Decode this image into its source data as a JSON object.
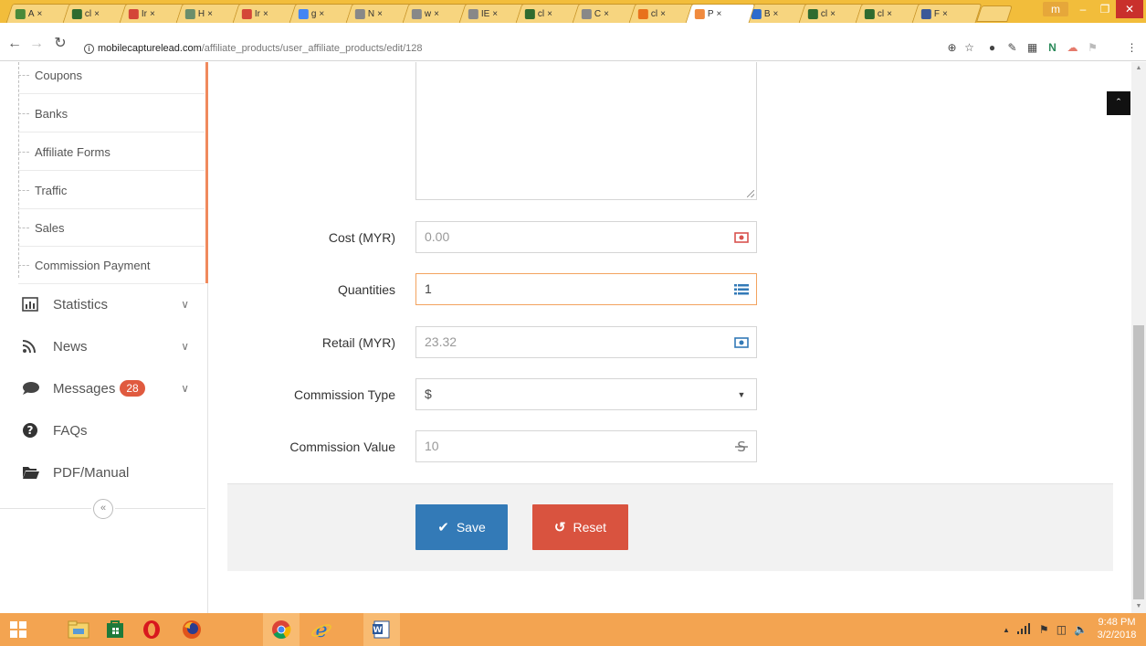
{
  "browser": {
    "tabs": [
      {
        "label": "A",
        "icon": "sheets-icon",
        "color": "#4a8a3a"
      },
      {
        "label": "cl",
        "icon": "circle-icon",
        "color": "#2f6b2f"
      },
      {
        "label": "Ir",
        "icon": "gmail-icon",
        "color": "#d44638"
      },
      {
        "label": "H",
        "icon": "page-icon",
        "color": "#6b8e6b"
      },
      {
        "label": "Ir",
        "icon": "gmail-icon",
        "color": "#d44638"
      },
      {
        "label": "g",
        "icon": "google-icon",
        "color": "#4285f4"
      },
      {
        "label": "N",
        "icon": "doc-icon",
        "color": "#888888"
      },
      {
        "label": "w",
        "icon": "doc-icon",
        "color": "#888888"
      },
      {
        "label": "IE",
        "icon": "doc-icon",
        "color": "#888888"
      },
      {
        "label": "cl",
        "icon": "circle-icon",
        "color": "#2f6b2f"
      },
      {
        "label": "C",
        "icon": "doc-icon",
        "color": "#888888"
      },
      {
        "label": "cl",
        "icon": "link-icon",
        "color": "#e8711c"
      },
      {
        "label": "P",
        "icon": "app-icon",
        "color": "#f08a3e"
      },
      {
        "label": "B",
        "icon": "b-icon",
        "color": "#2d6bcc"
      },
      {
        "label": "cl",
        "icon": "circle-icon",
        "color": "#2f6b2f"
      },
      {
        "label": "cl",
        "icon": "circle-icon",
        "color": "#2f6b2f"
      },
      {
        "label": "F",
        "icon": "facebook-icon",
        "color": "#3b5998"
      }
    ],
    "active_tab_index": 12,
    "profile_label": "m",
    "url_host": "mobilecapturelead.com",
    "url_path": "/affiliate_products/user_affiliate_products/edit/128"
  },
  "sidebar": {
    "subitems": [
      "Coupons",
      "Banks",
      "Affiliate Forms",
      "Traffic",
      "Sales",
      "Commission Payment"
    ],
    "items": [
      {
        "label": "Statistics",
        "icon": "bar-chart-icon",
        "has_chevron": true
      },
      {
        "label": "News",
        "icon": "rss-icon",
        "has_chevron": true
      },
      {
        "label": "Messages",
        "icon": "chat-bubble-icon",
        "has_chevron": true,
        "badge": "28"
      },
      {
        "label": "FAQs",
        "icon": "question-circle-icon",
        "has_chevron": false
      },
      {
        "label": "PDF/Manual",
        "icon": "folder-open-icon",
        "has_chevron": false
      }
    ],
    "collapse_glyph": "«"
  },
  "form": {
    "fields": [
      {
        "label": "Cost (MYR)",
        "value": "0.00",
        "icon": "money-icon"
      },
      {
        "label": "Quantities",
        "value": "1",
        "icon": "list-icon"
      },
      {
        "label": "Retail (MYR)",
        "value": "23.32",
        "icon": "money-icon"
      },
      {
        "label": "Commission Type",
        "value": "$",
        "icon": "caret-down-icon"
      },
      {
        "label": "Commission Value",
        "value": "10",
        "icon": "strikethrough-icon"
      }
    ],
    "save_label": "Save",
    "reset_label": "Reset"
  },
  "taskbar": {
    "time": "9:48 PM",
    "date": "3/2/2018"
  },
  "colors": {
    "accent": "#f08a5d",
    "save": "#337ab7",
    "reset": "#d9533f",
    "badge": "#e05a3f",
    "focus_border": "#f3a35f"
  }
}
